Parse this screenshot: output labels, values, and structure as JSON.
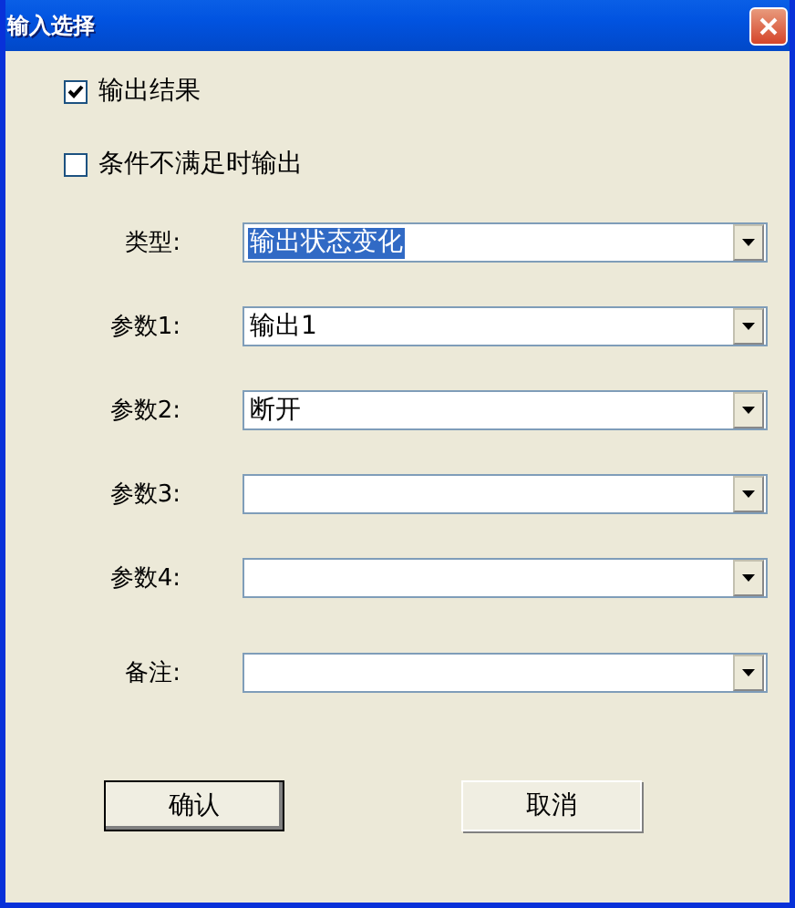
{
  "window": {
    "title": "输入选择"
  },
  "checkboxes": [
    {
      "label": "输出结果",
      "checked": true
    },
    {
      "label": "条件不满足时输出",
      "checked": false
    }
  ],
  "fields": [
    {
      "label": "类型:",
      "value": "输出状态变化",
      "highlighted": true
    },
    {
      "label": "参数1:",
      "value": "输出1",
      "highlighted": false
    },
    {
      "label": "参数2:",
      "value": "断开",
      "highlighted": false
    },
    {
      "label": "参数3:"
    },
    {
      "label": "参数4:"
    },
    {
      "label": "备注:"
    }
  ],
  "buttons": [
    {
      "label": "确认",
      "default": true
    },
    {
      "label": "取消",
      "default": false
    }
  ]
}
